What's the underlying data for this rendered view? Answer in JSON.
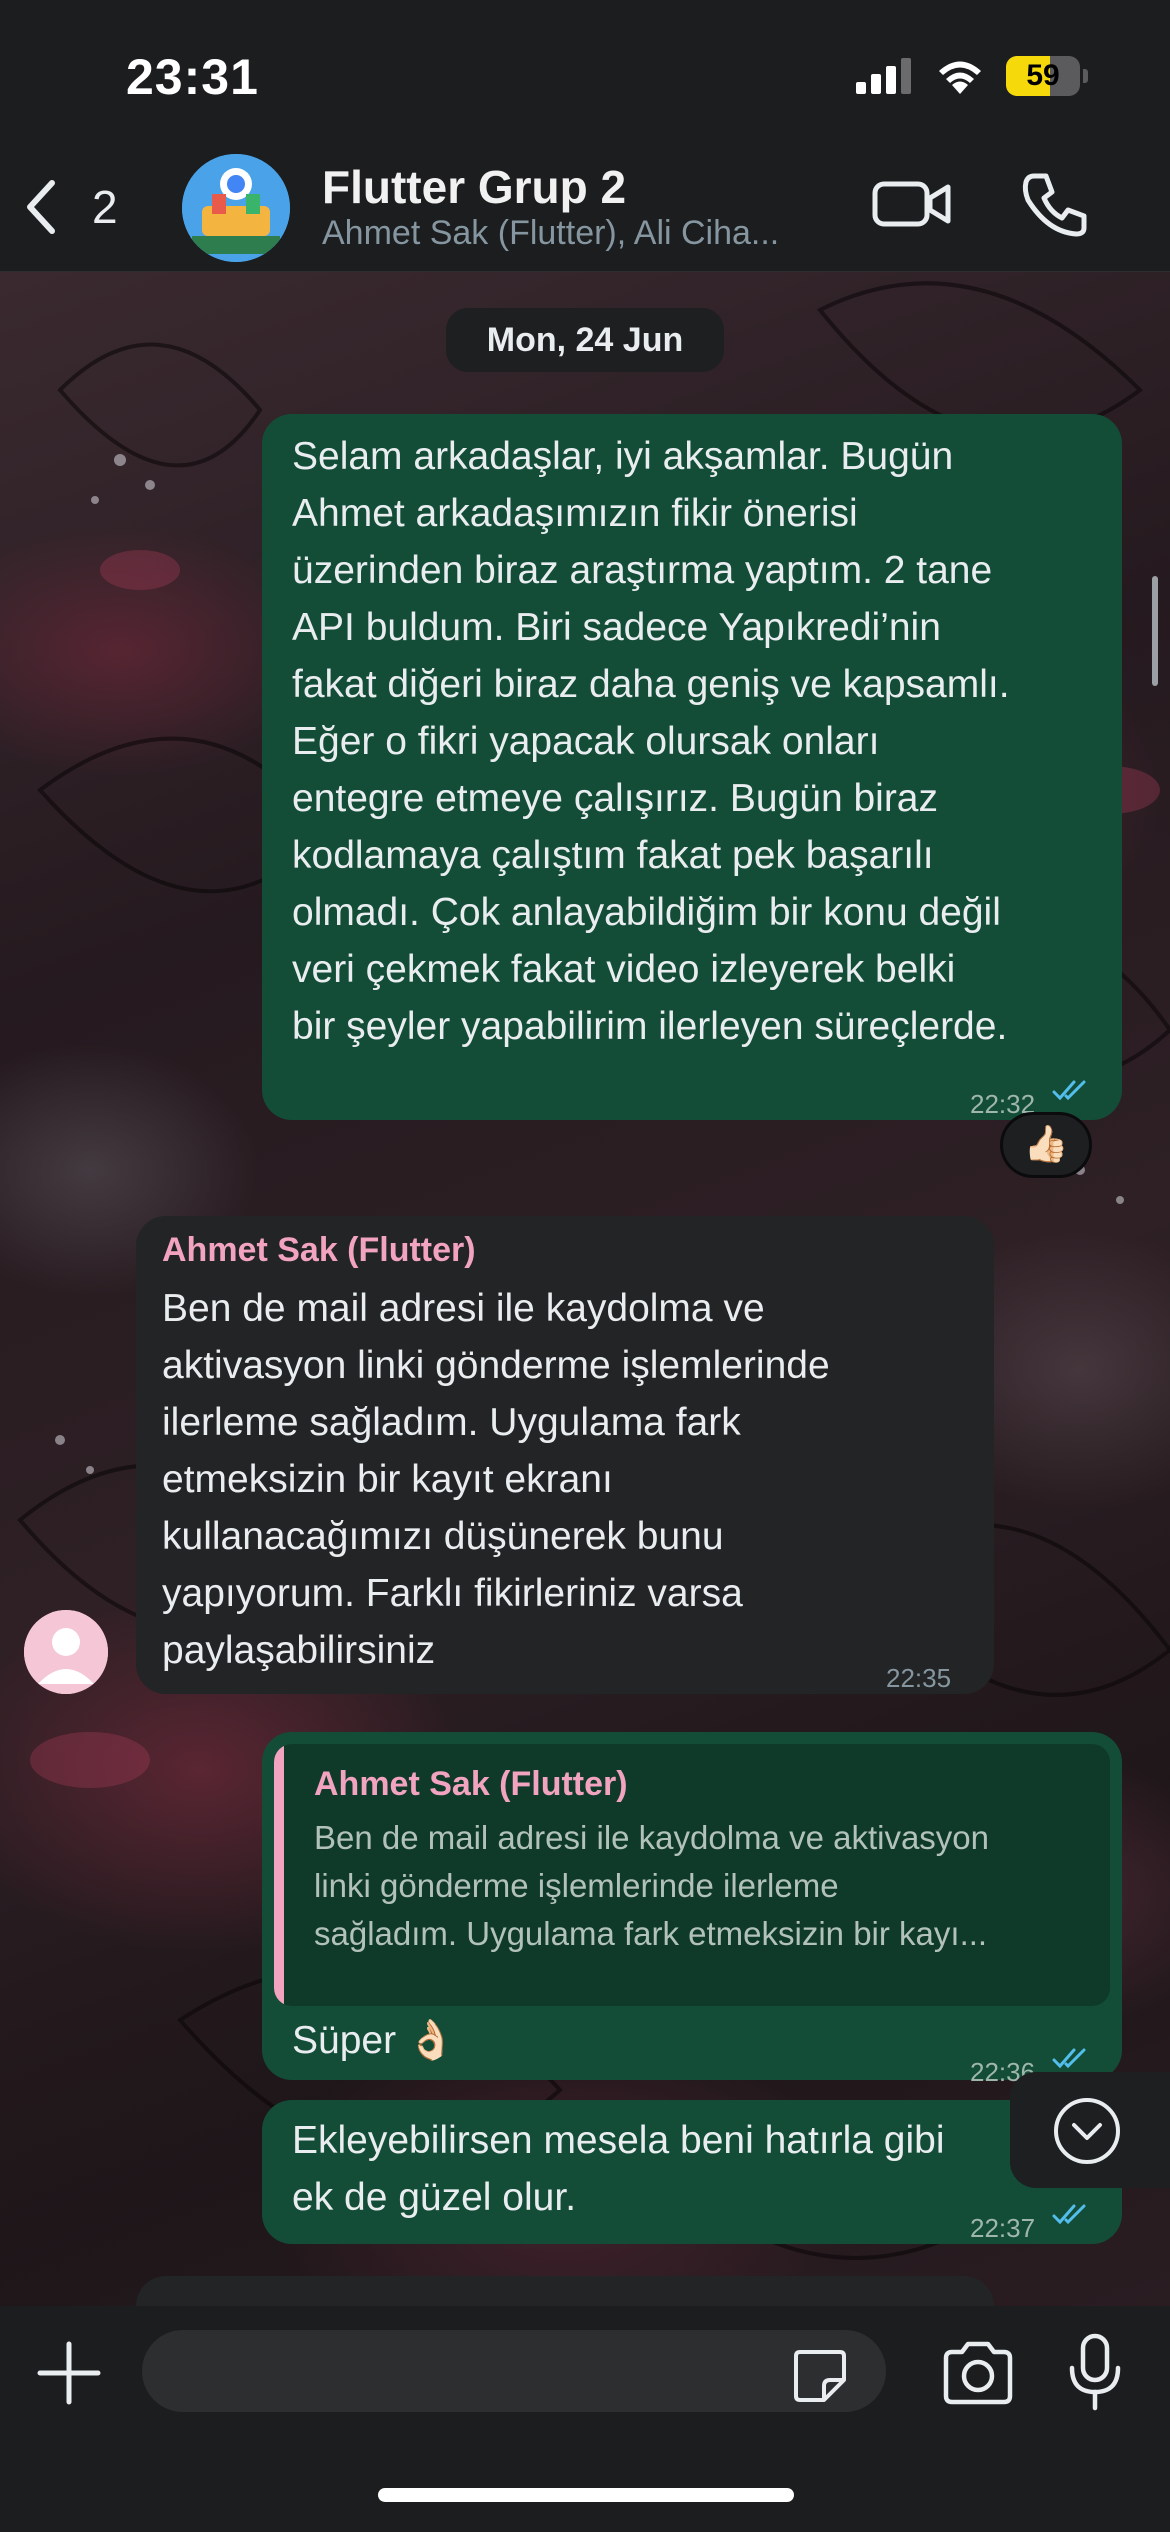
{
  "status_bar": {
    "time": "23:31",
    "battery": "59",
    "battery_level_percent": 59
  },
  "header": {
    "back_count": "2",
    "group_name": "Flutter Grup 2",
    "members": "Ahmet Sak (Flutter), Ali Ciha..."
  },
  "date_separator": "Mon, 24 Jun",
  "messages": [
    {
      "direction": "outgoing",
      "text": "Selam arkadaşlar, iyi akşamlar. Bugün\nAhmet arkadaşımızın fikir önerisi\nüzerinden biraz araştırma yaptım. 2 tane\nAPI buldum. Biri sadece Yapıkredi’nin\nfakat diğeri biraz daha geniş ve kapsamlı.\nEğer o fikri yapacak olursak onları\nentegre etmeye çalışırız. Bugün biraz\nkodlamaya çalıştım fakat pek başarılı\nolmadı. Çok anlayabildiğim bir konu değil\nveri çekmek fakat video izleyerek belki\nbir şeyler yapabilirim ilerleyen süreçlerde.",
      "time": "22:32",
      "reaction": "👍🏻"
    },
    {
      "direction": "incoming",
      "sender": "Ahmet Sak (Flutter)",
      "text": "Ben de mail adresi ile kaydolma ve\naktivasyon linki gönderme işlemlerinde\nilerleme sağladım. Uygulama fark\netmeksizin bir kayıt ekranı\nkullanacağımızı düşünerek bunu\nyapıyorum. Farklı fikirleriniz varsa\npaylaşabilirsiniz",
      "time": "22:35"
    },
    {
      "direction": "outgoing",
      "quote_sender": "Ahmet Sak (Flutter)",
      "quote_text": "Ben de mail adresi ile kaydolma ve aktivasyon\nlinki gönderme işlemlerinde ilerleme\nsağladım. Uygulama fark etmeksizin bir kayı...",
      "text": "Süper 👌🏻",
      "time": "22:36"
    },
    {
      "direction": "outgoing",
      "text": "Ekleyebilirsen mesela beni hatırla gibi\nek de güzel olur.",
      "time": "22:37"
    }
  ],
  "composer": {
    "placeholder": ""
  },
  "colors": {
    "outgoing_bubble": "#134d37",
    "incoming_bubble": "#222425",
    "read_ticks": "#53bdeb",
    "sender_name": "#f1a3c0",
    "battery": "#f5d90a"
  }
}
